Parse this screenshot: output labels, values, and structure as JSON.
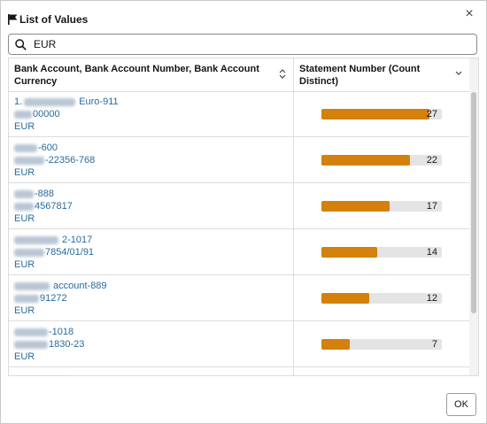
{
  "dialog": {
    "title": "List of Values",
    "close_label": "×",
    "ok_label": "OK"
  },
  "search": {
    "value": "EUR",
    "placeholder": ""
  },
  "table": {
    "columns": [
      {
        "label": "Bank Account, Bank Account Number, Bank Account Currency"
      },
      {
        "label": "Statement Number (Count Distinct)"
      }
    ],
    "max_value": 30,
    "rows": [
      {
        "line1": "Euro-911",
        "line1_prefix": "1.",
        "line2": "00000",
        "line3": "EUR",
        "value": 27,
        "value_label": "27"
      },
      {
        "line1": "-600",
        "line1_prefix": "",
        "line2": "-22356-768",
        "line3": "EUR",
        "value": 22,
        "value_label": "22"
      },
      {
        "line1": "-888",
        "line1_prefix": "",
        "line2": "4567817",
        "line3": "EUR",
        "value": 17,
        "value_label": "17"
      },
      {
        "line1": "2-1017",
        "line1_prefix": "",
        "line2": "7854/01/91",
        "line3": "EUR",
        "value": 14,
        "value_label": "14"
      },
      {
        "line1": "account-889",
        "line1_prefix": "",
        "line2": "91272",
        "line3": "EUR",
        "value": 12,
        "value_label": "12"
      },
      {
        "line1": "-1018",
        "line1_prefix": "",
        "line2": "1830-23",
        "line3": "EUR",
        "value": 7,
        "value_label": "7"
      },
      {
        "line1": "",
        "line1_prefix": "",
        "line2": "",
        "line3": "",
        "value": null,
        "value_label": ""
      }
    ]
  },
  "colors": {
    "bar_fill": "#d4800b",
    "bar_track": "#e4e4e4",
    "link_text": "#2a6a9c"
  }
}
